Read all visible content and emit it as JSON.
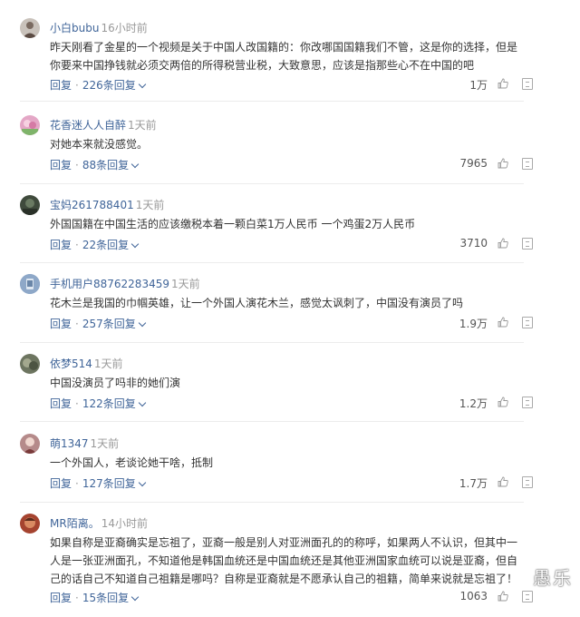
{
  "comments": [
    {
      "user": "小白bubu",
      "time": "16小时前",
      "text": "昨天刚看了金星的一个视频是关于中国人改国籍的：你改哪国国籍我们不管，这是你的选择，但是你要来中国挣钱就必须交两倍的所得税营业税，大致意思，应该是指那些心不在中国的吧",
      "reply_label": "回复",
      "replies_label": "226条回复",
      "likes": "1万",
      "avatar_color": "#c9c2bb"
    },
    {
      "user": "花香迷人人自醉",
      "time": "1天前",
      "text": "对她本来就没感觉。",
      "reply_label": "回复",
      "replies_label": "88条回复",
      "likes": "7965",
      "avatar_color": "#e4a7c6"
    },
    {
      "user": "宝妈261788401",
      "time": "1天前",
      "text": "外国国籍在中国生活的应该缴税本着一颗白菜1万人民币  一个鸡蛋2万人民币",
      "reply_label": "回复",
      "replies_label": "22条回复",
      "likes": "3710",
      "avatar_color": "#3f4a3c"
    },
    {
      "user": "手机用户88762283459",
      "time": "1天前",
      "text": "花木兰是我国的巾帼英雄，让一个外国人演花木兰，感觉太讽刺了，中国没有演员了吗",
      "reply_label": "回复",
      "replies_label": "257条回复",
      "likes": "1.9万",
      "avatar_color": "#8ea8c8"
    },
    {
      "user": "依梦514",
      "time": "1天前",
      "text": "中国没演员了吗非的她们演",
      "reply_label": "回复",
      "replies_label": "122条回复",
      "likes": "1.2万",
      "avatar_color": "#6d7560"
    },
    {
      "user": "萌1347",
      "time": "1天前",
      "text": "一个外国人，老谈论她干啥，抵制",
      "reply_label": "回复",
      "replies_label": "127条回复",
      "likes": "1.7万",
      "avatar_color": "#b58a8a"
    },
    {
      "user": "MR陌离。",
      "time": "14小时前",
      "text": "如果自称是亚裔确实是忘祖了，亚裔一般是别人对亚洲面孔的的称呼，如果两人不认识，但其中一人是一张亚洲面孔，不知道他是韩国血统还是中国血统还是其他亚洲国家血统可以说是亚裔，但自己的话自己不知道自己祖籍是哪吗？自称是亚裔就是不愿承认自己的祖籍，简单来说就是忘祖了！",
      "reply_label": "回复",
      "replies_label": "15条回复",
      "likes": "1063",
      "avatar_color": "#a5432f"
    }
  ],
  "watermark": "愚乐"
}
